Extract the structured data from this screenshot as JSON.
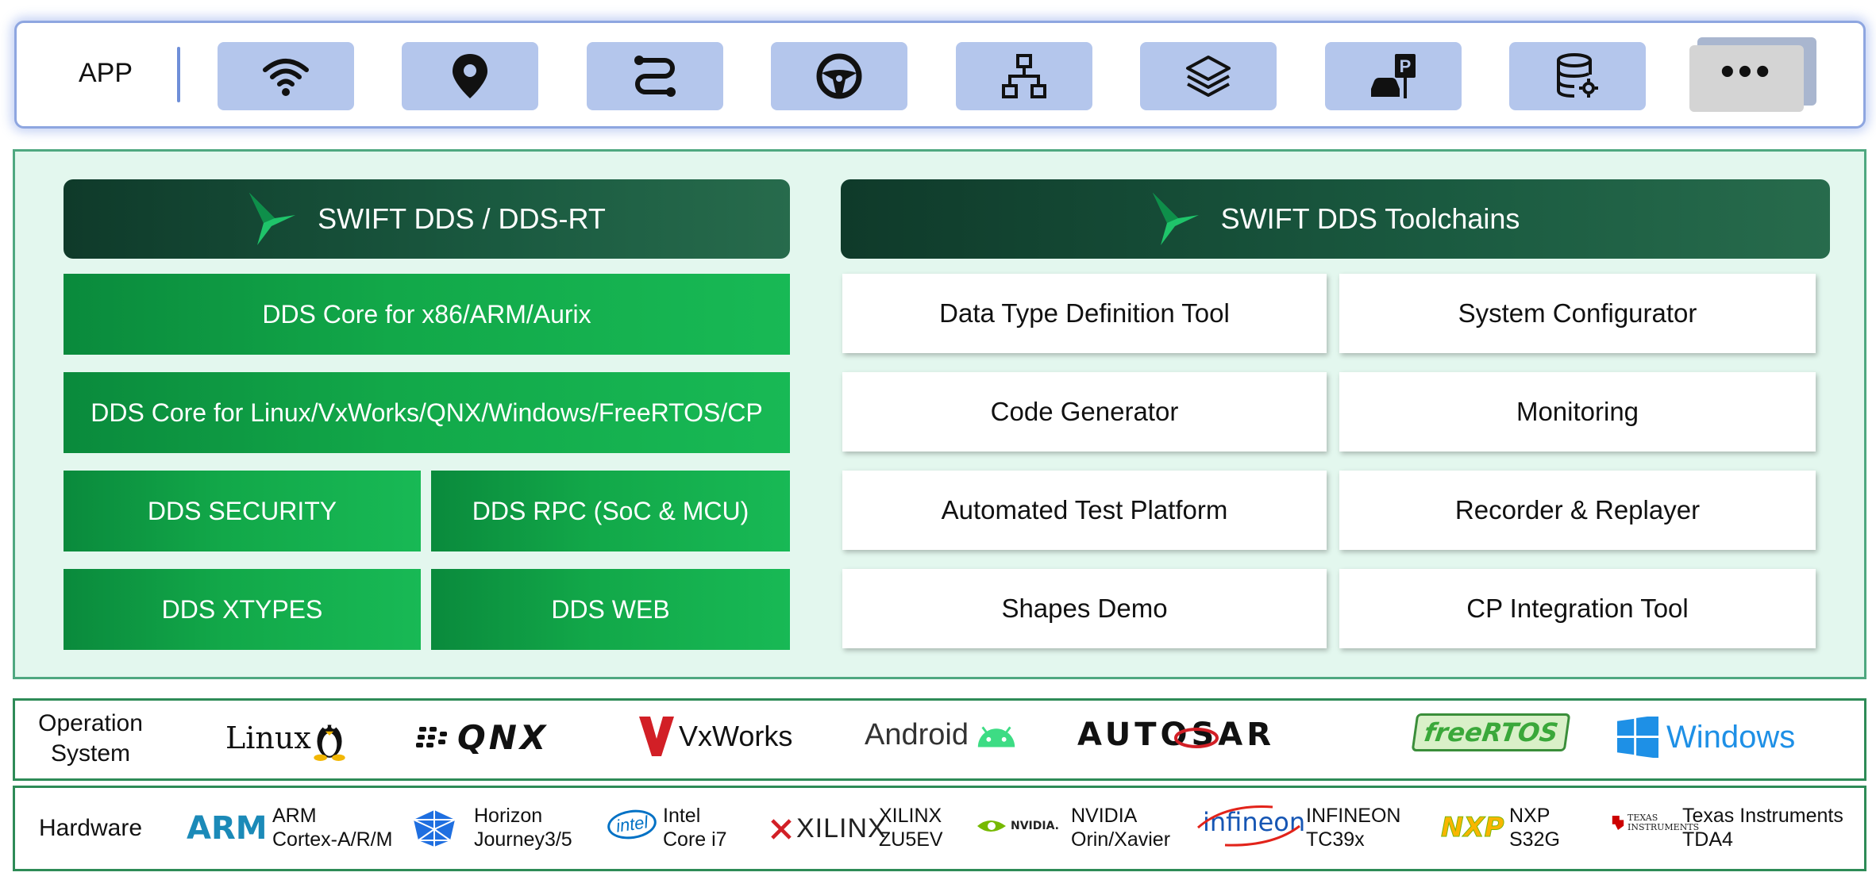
{
  "app_bar": {
    "label": "APP",
    "more_label": "•••",
    "icons": [
      "wifi-icon",
      "location-pin-icon",
      "route-icon",
      "steering-wheel-icon",
      "hierarchy-icon",
      "layers-icon",
      "parking-icon",
      "database-settings-icon"
    ]
  },
  "dds_runtime": {
    "title": "SWIFT DDS / DDS-RT",
    "core_arch": "DDS Core for x86/ARM/Aurix",
    "core_os": "DDS Core for Linux/VxWorks/QNX/Windows/FreeRTOS/CP",
    "security": "DDS SECURITY",
    "rpc": "DDS RPC (SoC & MCU)",
    "xtypes": "DDS XTYPES",
    "web": "DDS WEB"
  },
  "toolchains": {
    "title": "SWIFT DDS Toolchains",
    "tools": [
      "Data Type Definition Tool",
      "System Configurator",
      "Code Generator",
      "Monitoring",
      "Automated Test Platform",
      "Recorder & Replayer",
      "Shapes Demo",
      "CP Integration Tool"
    ]
  },
  "os_row": {
    "label_line1": "Operation",
    "label_line2": "System",
    "logos": [
      "Linux",
      "QNX",
      "VxWorks",
      "Android",
      "AUTOSAR",
      "freeRTOS",
      "Windows"
    ]
  },
  "hw_row": {
    "label": "Hardware",
    "items": [
      {
        "logo": "ARM",
        "line1": "ARM",
        "line2": "Cortex-A/R/M"
      },
      {
        "logo": "",
        "line1": "Horizon",
        "line2": "Journey3/5"
      },
      {
        "logo": "intel",
        "line1": "Intel",
        "line2": "Core i7"
      },
      {
        "logo": "XILINX",
        "line1": "XILINX",
        "line2": "ZU5EV"
      },
      {
        "logo": "NVIDIA.",
        "line1": "NVIDIA",
        "line2": "Orin/Xavier"
      },
      {
        "logo": "infineon",
        "line1": "INFINEON",
        "line2": "TC39x"
      },
      {
        "logo": "NXP",
        "line1": "NXP",
        "line2": "S32G"
      },
      {
        "logo": "TEXAS INSTRUMENTS",
        "line1": "Texas Instruments",
        "line2": "TDA4"
      }
    ]
  },
  "colors": {
    "app_icon_bg": "#b4c6ec",
    "green_box": "#12a849",
    "dark_header": "#1a5a40",
    "panel_bg": "#e3f7ee"
  }
}
